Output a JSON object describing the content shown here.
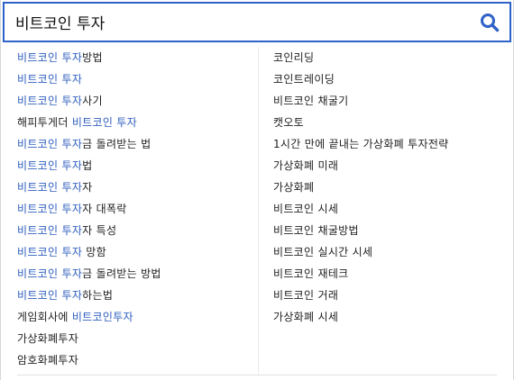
{
  "search": {
    "value": "비트코인 투자",
    "button_icon": "search-icon",
    "accent_color": "#2f62c8"
  },
  "suggestions_left": [
    {
      "before": "",
      "match": "비트코인 투자",
      "after": "방법"
    },
    {
      "before": "",
      "match": "비트코인 투자",
      "after": ""
    },
    {
      "before": "",
      "match": "비트코인 투자",
      "after": "사기"
    },
    {
      "before": "해피투게더 ",
      "match": "비트코인 투자",
      "after": ""
    },
    {
      "before": "",
      "match": "비트코인 투자",
      "after": "금 돌려받는 법"
    },
    {
      "before": "",
      "match": "비트코인 투자",
      "after": "법"
    },
    {
      "before": "",
      "match": "비트코인 투자",
      "after": "자"
    },
    {
      "before": "",
      "match": "비트코인 투자",
      "after": "자 대폭락"
    },
    {
      "before": "",
      "match": "비트코인 투자",
      "after": "자 특성"
    },
    {
      "before": "",
      "match": "비트코인 투자",
      "after": " 망함"
    },
    {
      "before": "",
      "match": "비트코인 투자",
      "after": "금 돌려받는 방법"
    },
    {
      "before": "",
      "match": "비트코인 투자",
      "after": "하는법"
    },
    {
      "before": "게임회사에 ",
      "match": "비트코인투자",
      "after": ""
    },
    {
      "before": "가상화폐투자",
      "match": "",
      "after": ""
    },
    {
      "before": "암호화폐투자",
      "match": "",
      "after": ""
    }
  ],
  "suggestions_right": [
    "코인리딩",
    "코인트레이딩",
    "비트코인 채굴기",
    "캣오토",
    "1시간 만에 끝내는 가상화폐 투자전략",
    "가상화폐 미래",
    "가상화폐",
    "비트코인 시세",
    "비트코인 채굴방법",
    "비트코인 실시간 시세",
    "비트코인 재테크",
    "비트코인 거래",
    "가상화폐 시세"
  ],
  "colors": {
    "highlight": "#2f5fbf",
    "border": "#2f62c8"
  }
}
